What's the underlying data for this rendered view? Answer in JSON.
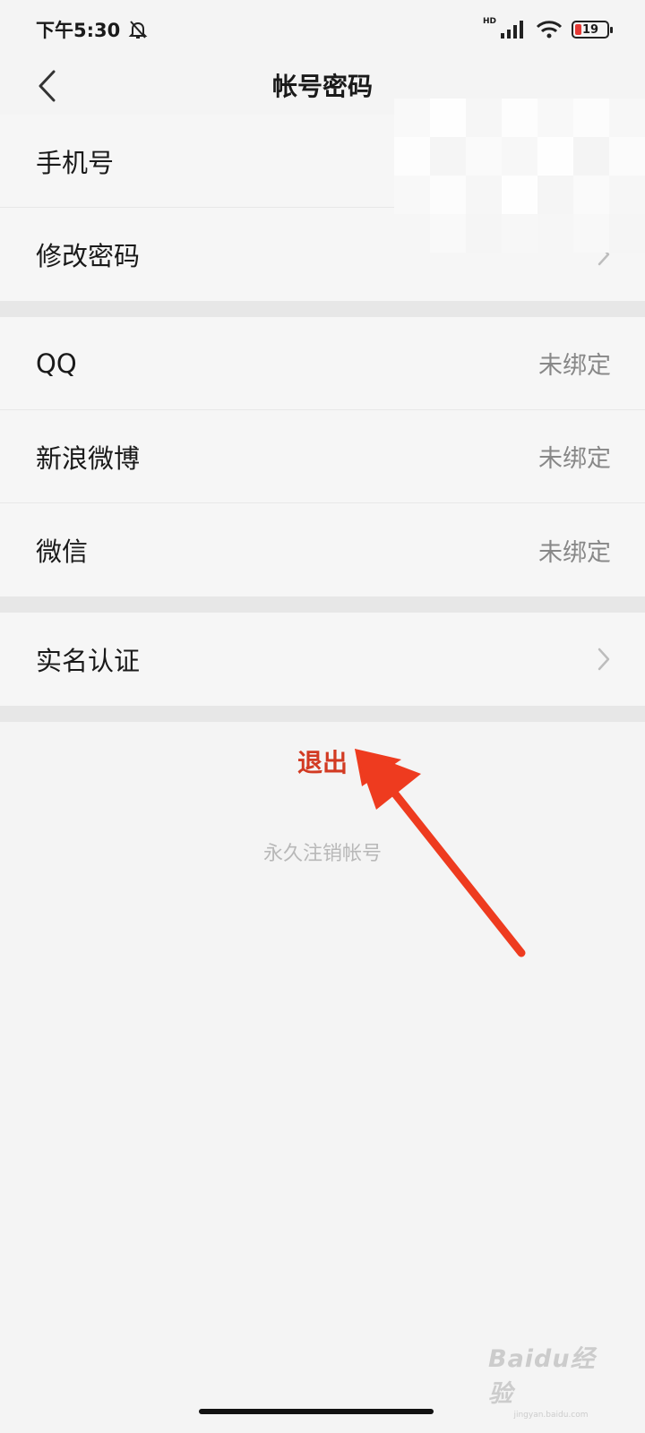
{
  "status_bar": {
    "time": "下午5:30",
    "network_label": "HD",
    "battery_level": "19",
    "icons": [
      "bell-off-icon",
      "signal-icon",
      "wifi-icon",
      "battery-icon"
    ],
    "battery_color": "#e53935"
  },
  "nav": {
    "title": "帐号密码",
    "back_icon": "chevron-left-icon"
  },
  "account_group": {
    "items": [
      {
        "label": "手机号",
        "value": ""
      },
      {
        "label": "修改密码",
        "icon": "chevron-right-icon"
      }
    ]
  },
  "bind_group": {
    "items": [
      {
        "label": "QQ",
        "value": "未绑定"
      },
      {
        "label": "新浪微博",
        "value": "未绑定"
      },
      {
        "label": "微信",
        "value": "未绑定"
      }
    ]
  },
  "verify_group": {
    "items": [
      {
        "label": "实名认证",
        "icon": "chevron-right-icon"
      }
    ]
  },
  "actions": {
    "logout_label": "退出",
    "logout_color": "#d23a22",
    "deregister_label": "永久注销帐号"
  },
  "annotation": {
    "arrow_color": "#ee3b1f",
    "icon": "red-arrow-icon"
  },
  "watermark": {
    "main_text": "Baidu经验",
    "sub_text": "jingyan.baidu.com"
  }
}
